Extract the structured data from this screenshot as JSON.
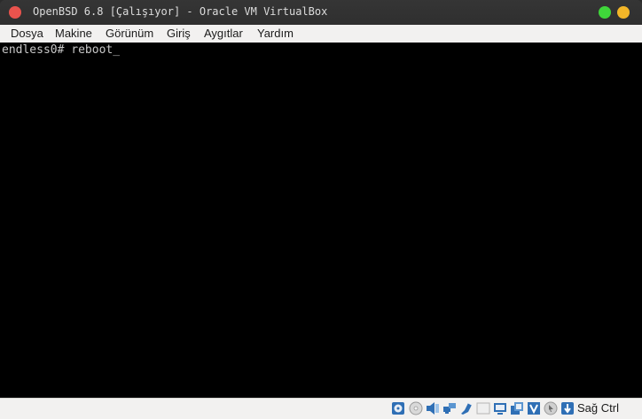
{
  "window": {
    "title": "OpenBSD 6.8 [Çalışıyor] - Oracle VM VirtualBox"
  },
  "menubar": {
    "items": [
      {
        "label": "Dosya"
      },
      {
        "label": "Makine"
      },
      {
        "label": "Görünüm"
      },
      {
        "label": "Giriş"
      },
      {
        "label": "Aygıtlar"
      },
      {
        "label": "Yardım"
      }
    ]
  },
  "console": {
    "prompt_line": "endless0# reboot_"
  },
  "statusbar": {
    "icons": [
      "hard-disk-icon",
      "optical-drive-icon",
      "audio-icon",
      "network-icon",
      "usb-icon",
      "shared-folders-icon",
      "display-icon",
      "video-capture-icon",
      "virtualization-icon",
      "mouse-integration-icon"
    ],
    "host_key_label": "Sağ Ctrl"
  },
  "colors": {
    "close": "#e9534d",
    "minimize": "#3fd63a",
    "maximize": "#f3b628",
    "console_bg": "#000000",
    "console_fg": "#c8c8c8"
  }
}
